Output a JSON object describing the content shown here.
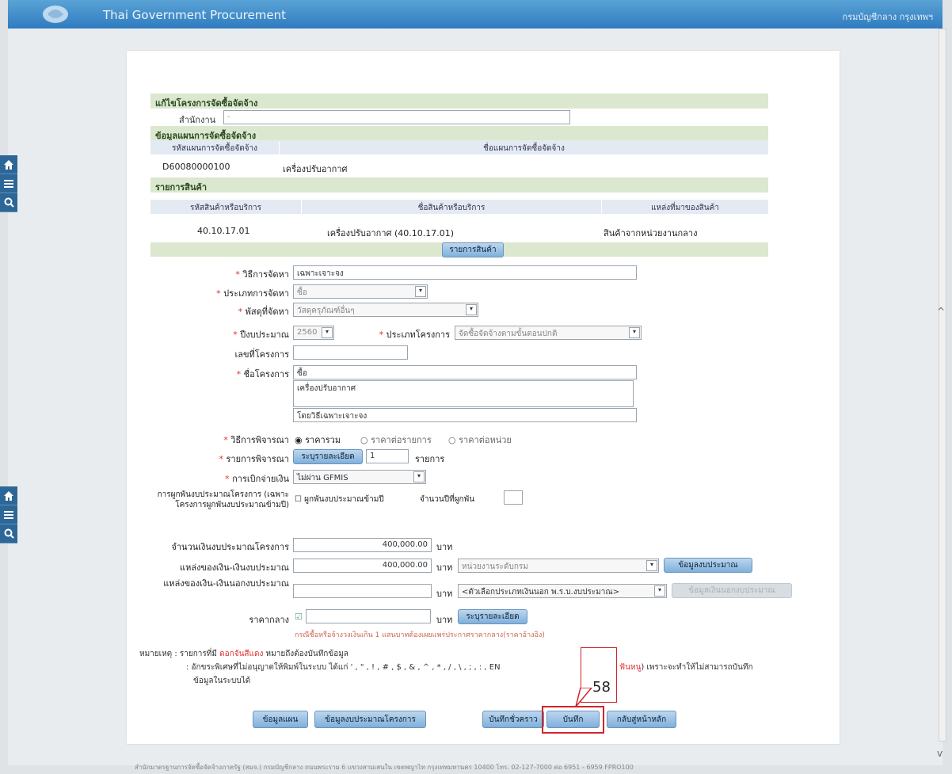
{
  "header": {
    "title": "Thai Government Procurement",
    "dept": "กรมบัญชีกลาง กรุงเทพฯ"
  },
  "sections": {
    "project": "แก้ไขโครงการจัดซื้อจัดจ้าง",
    "agency_label": "สำนักงาน",
    "agency_value": "-",
    "plan": "ข้อมูลแผนการจัดซื้อจัดจ้าง",
    "plan_col1": "รหัสแผนการจัดซื้อจัดจ้าง",
    "plan_col2": "ชื่อแผนการจัดซื้อจัดจ้าง",
    "plan_code": "D60080000100",
    "plan_name": "เครื่องปรับอากาศ",
    "items": "รายการสินค้า",
    "items_col1": "รหัสสินค้าหรือบริการ",
    "items_col2": "ชื่อสินค้าหรือบริการ",
    "items_col3": "แหล่งที่มาของสินค้า",
    "item_code": "40.10.17.01",
    "item_name": "เครื่องปรับอากาศ (40.10.17.01)",
    "item_source": "สินค้าจากหน่วยงานกลาง",
    "items_button": "รายการสินค้า"
  },
  "form": {
    "method_label": "วิธีการจัดหา",
    "method_value": "เฉพาะเจาะจง",
    "type_label": "ประเภทการจัดหา",
    "type_value": "ซื้อ",
    "supply_label": "พัสดุที่จัดหา",
    "supply_value": "วัสดุครุภัณฑ์อื่นๆ",
    "budget_year_label": "ปีงบประมาณ",
    "budget_year_value": "2560",
    "project_type_label": "ประเภทโครงการ",
    "project_type_value": "จัดซื้อจัดจ้างตามขั้นตอนปกติ",
    "project_no_label": "เลขที่โครงการ",
    "project_no_value": "",
    "project_name_label": "ชื่อโครงการ",
    "project_name_line1": "ซื้อ",
    "project_name_line2": "เครื่องปรับอากาศ",
    "project_name_line3": "โดยวิธีเฉพาะเจาะจง",
    "criteria_label": "วิธีการพิจารณา",
    "criteria_opt1": "ราคารวม",
    "criteria_opt2": "ราคาต่อรายการ",
    "criteria_opt3": "ราคาต่อหน่วย",
    "criteria_items_label": "รายการพิจารณา",
    "criteria_items_button": "ระบุรายละเอียด",
    "criteria_items_value": "1",
    "criteria_items_unit": "รายการ",
    "disburse_label": "การเบิกจ่ายเงิน",
    "disburse_value": "ไม่ผ่าน GFMIS",
    "commit_label": "การผูกพันงบประมาณโครงการ (เฉพาะโครงการผูกพันงบประมาณข้ามปี)",
    "commit_check": "ผูกพันงบประมาณข้ามปี",
    "commit_years_label": "จำนวนปีที่ผูกพัน",
    "budget_label": "จำนวนเงินงบประมาณโครงการ",
    "budget_value": "400,000.00",
    "baht": "บาท",
    "source_label": "แหล่งของเงิน-เงินงบประมาณ",
    "source_value": "400,000.00",
    "source_select": "หน่วยงานระดับกรม",
    "source_button": "ข้อมูลงบประมาณ",
    "outside_label": "แหล่งของเงิน-เงินนอกงบประมาณ",
    "outside_value": "",
    "outside_select": "<ตัวเลือกประเภทเงินนอก พ.ร.บ.งบประมาณ>",
    "outside_button": "ข้อมูลเงินนอกงบประมาณ",
    "median_label": "ราคากลาง",
    "median_value": "",
    "median_button": "ระบุรายละเอียด",
    "median_note": "กรณีซื้อหรือจ้างวงเงินเกิน 1 แสนบาทต้องเผยแพร่ประกาศราคากลาง(ราคาอ้างอิง)"
  },
  "notes": {
    "prefix": "หมายเหตุ :",
    "line1a": "รายการที่มี",
    "line1b": "ดอกจันสีแดง",
    "line1c": "หมายถึงต้องบันทึกข้อมูล",
    "line2a": ": อักขระพิเศษที่ไม่อนุญาตให้พิมพ์ในระบบ ได้แก่ ' , \" , ! , # , $ , & , ^ , * , / , \\ , ; , : , EN",
    "line2b": "ฟันหนู",
    "line2c": ") เพราะจะทำให้ไม่สามารถบันทึก",
    "line3": "ข้อมูลในระบบได้"
  },
  "buttons": {
    "b1": "ข้อมูลแผน",
    "b2": "ข้อมูลงบประมาณโครงการ",
    "b3": "บันทึกชั่วคราว",
    "b4": "บันทึก",
    "b5": "กลับสู่หน้าหลัก"
  },
  "annotation": {
    "step": "58"
  },
  "footer": "สำนักมาตรฐานการจัดซื้อจัดจ้างภาครัฐ (สมจ.) กรมบัญชีกลาง ถนนพระราม 6 แขวงสามเสนใน เขตพญาไท กรุงเทพมหานคร 10400 โทร. 02-127-7000 ต่อ 6951 - 6959          FPRO100",
  "icons": {
    "home": "home-icon",
    "menu": "menu-icon",
    "search": "search-icon"
  }
}
